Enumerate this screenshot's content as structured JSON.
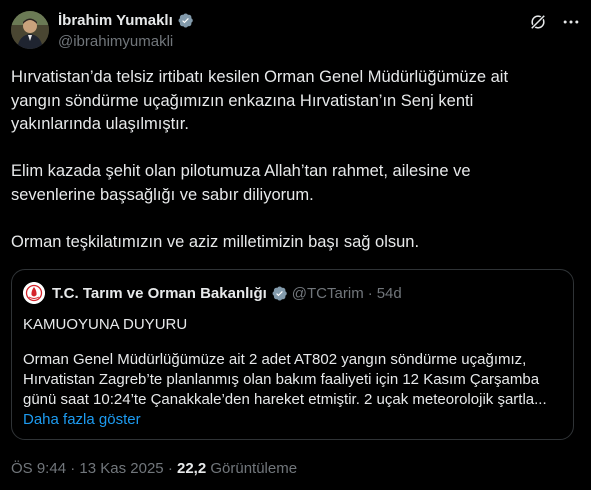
{
  "author": {
    "name": "İbrahim Yumaklı",
    "handle": "@ibrahimyumakli",
    "avatar_icon": "profile-photo",
    "verified_color": "#829aab"
  },
  "actions": {
    "grok_icon": "grok-icon",
    "more_icon": "more-horizontal-icon"
  },
  "tweet_text": "Hırvatistan’da telsiz irtibatı kesilen Orman Genel Müdürlüğümüze ait\nyangın söndürme uçağımızın enkazına Hırvatistan’ın Senj kenti\nyakınlarında ulaşılmıştır.\n\nElim kazada şehit olan pilotumuza Allah’tan rahmet, ailesine ve\nsevenlerine başsağlığı ve sabır diliyorum.\n\nOrman teşkilatımızın ve aziz milletimizin başı sağ olsun.",
  "quote": {
    "name": "T.C. Tarım ve Orman Bakanlığı",
    "handle": "@TCTarim",
    "separator": "·",
    "age": "54d",
    "verified_color": "#829aab",
    "title": "KAMUOYUNA DUYURU",
    "text": "Orman Genel Müdürlüğümüze ait 2 adet AT802 yangın söndürme uçağımız,\nHırvatistan Zagreb’te planlanmış olan bakım faaliyeti için 12 Kasım Çarşamba\ngünü saat 10:24’te Çanakkale’den hareket etmiştir. 2 uçak meteorolojik şartla...",
    "show_more": "Daha fazla göster"
  },
  "meta": {
    "time": "ÖS 9:44",
    "separator": "·",
    "date": "13 Kas 2025",
    "views": "22,2",
    "views_label": "Görüntüleme"
  }
}
